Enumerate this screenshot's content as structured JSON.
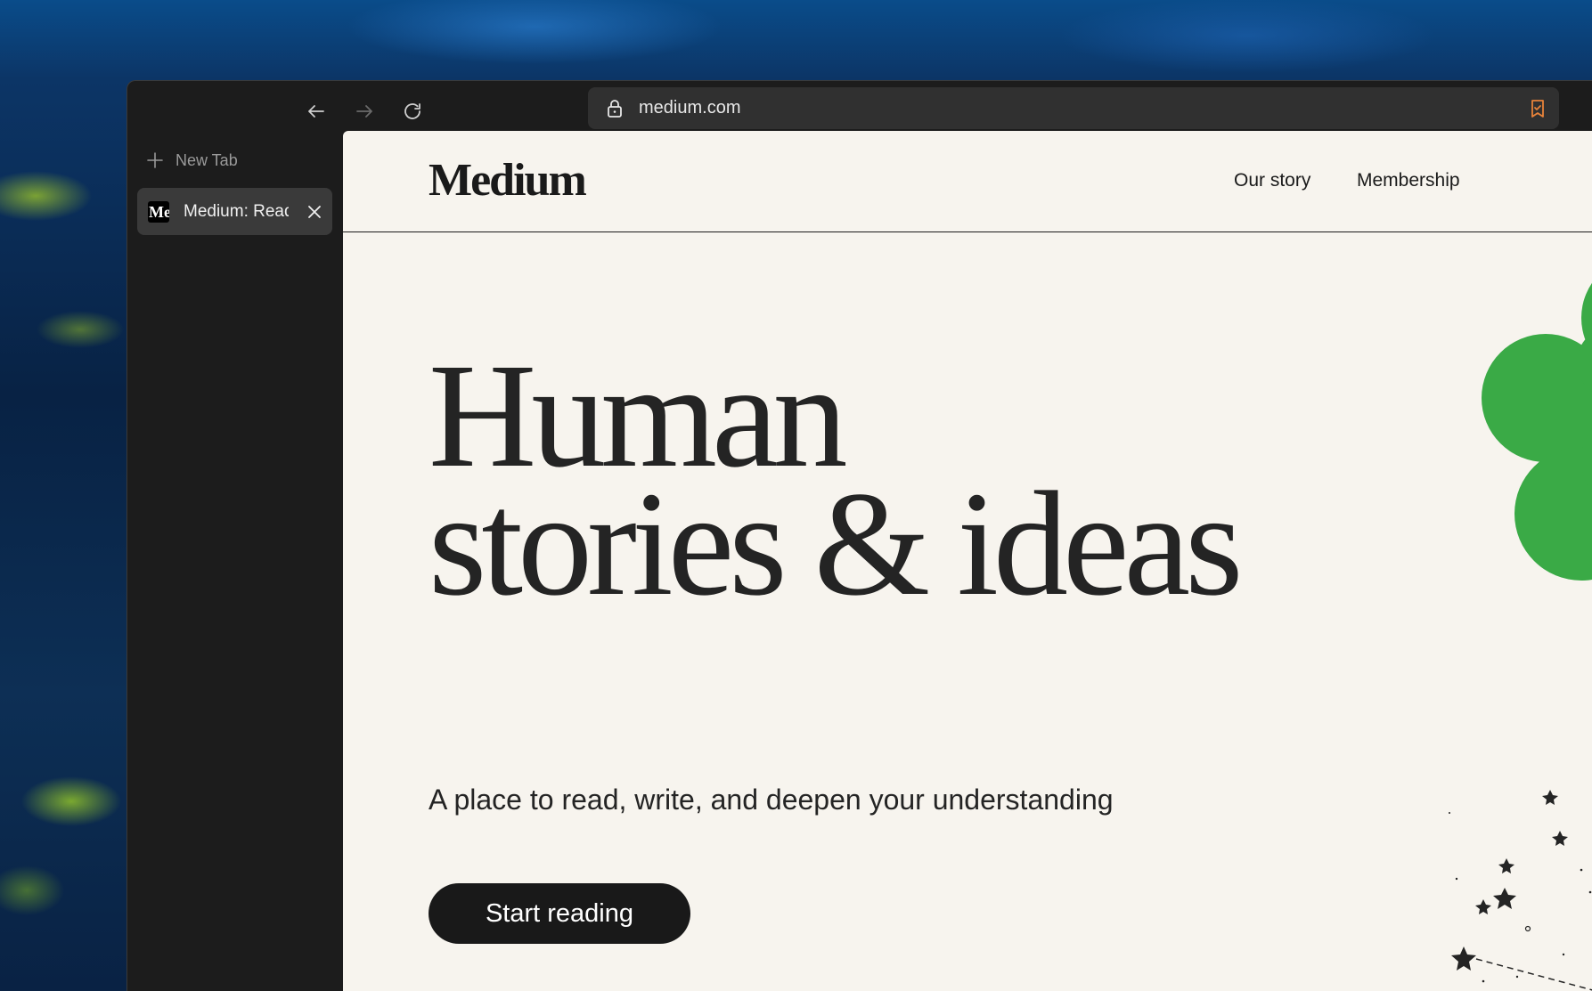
{
  "browser": {
    "url": "medium.com",
    "new_tab_label": "New Tab",
    "tabs": [
      {
        "title": "Medium: Read",
        "favicon_text": "Medium",
        "active": true
      }
    ],
    "icons": [
      "back-arrow-icon",
      "forward-arrow-icon",
      "reload-icon",
      "lock-icon",
      "bookmark-icon",
      "plus-icon",
      "close-icon"
    ]
  },
  "site": {
    "logo": "Medium",
    "nav": {
      "our_story": "Our story",
      "membership": "Membership"
    },
    "hero": {
      "title_line1": "Human",
      "title_line2": "stories & ideas",
      "subtitle": "A place to read, write, and deepen your understanding",
      "cta": "Start reading"
    }
  },
  "colors": {
    "page_bg": "#f7f4ee",
    "accent_green": "#3aaa46",
    "text_dark": "#242424",
    "browser_chrome": "#1c1c1c",
    "bookmark_orange": "#e8833a"
  }
}
